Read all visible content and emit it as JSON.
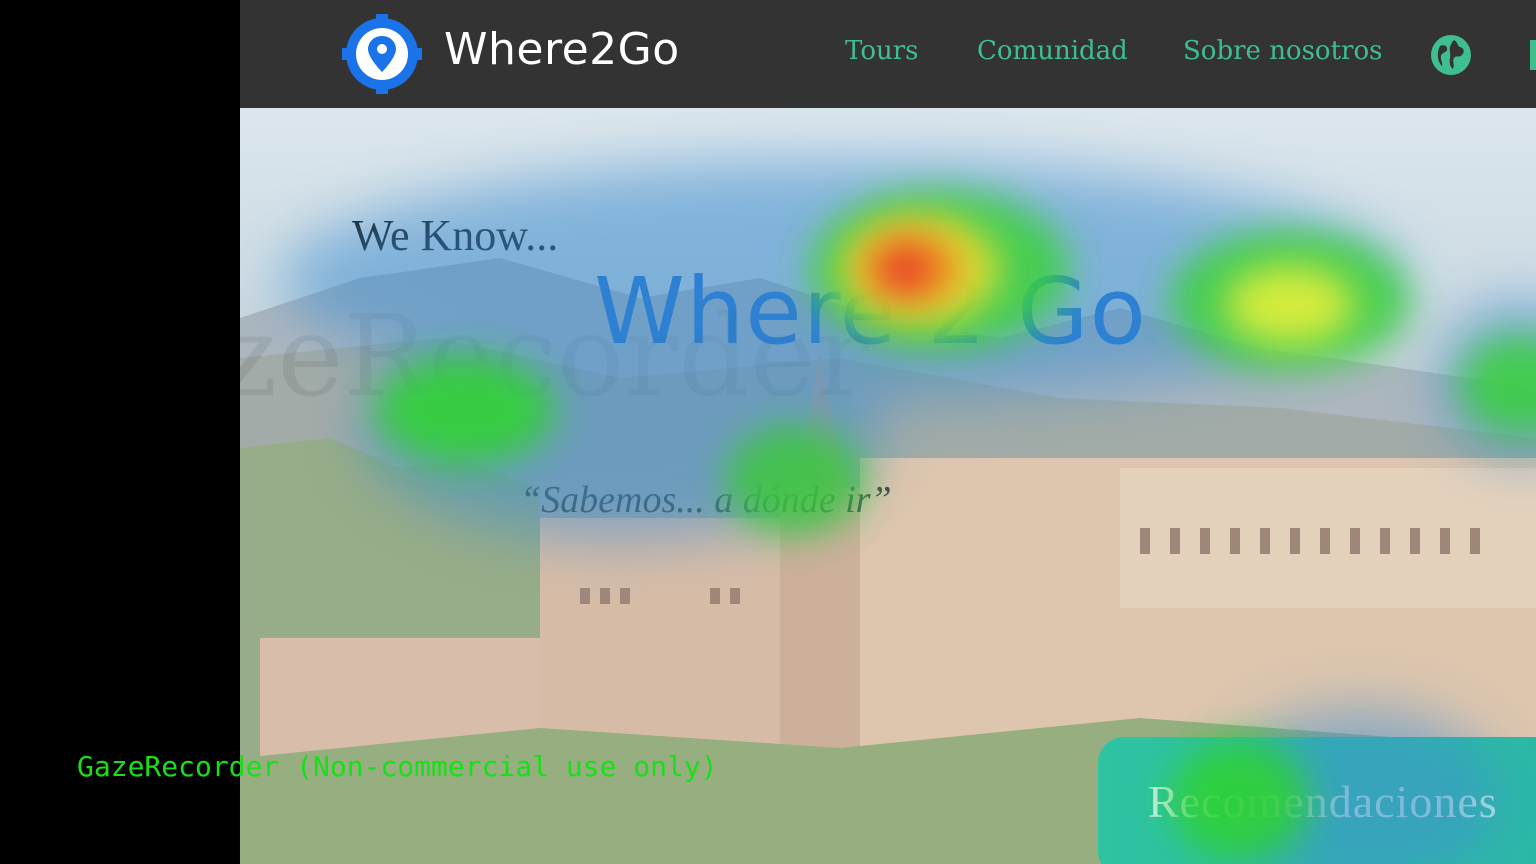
{
  "brand": {
    "name": "Where2Go",
    "logo_icon": "map-pin-gear-icon",
    "logo_color": "#1a73e8"
  },
  "nav": {
    "links": [
      {
        "label": "Tours"
      },
      {
        "label": "Comunidad"
      },
      {
        "label": "Sobre nosotros"
      }
    ],
    "language_icon": "globe-icon",
    "link_color": "#3fbf8f",
    "bar_color": "#333333"
  },
  "hero": {
    "kicker": "We Know...",
    "title": "Where 2 Go",
    "tagline": "“Sabemos... a dónde ir”",
    "button_label": "Recomendaciones",
    "title_color": "#1a6fd8",
    "button_color": "#2fc3a2"
  },
  "overlay": {
    "watermark": "GazeRecorder",
    "credit": "GazeRecorder (Non-commercial use only)",
    "credit_color": "#18e018"
  }
}
